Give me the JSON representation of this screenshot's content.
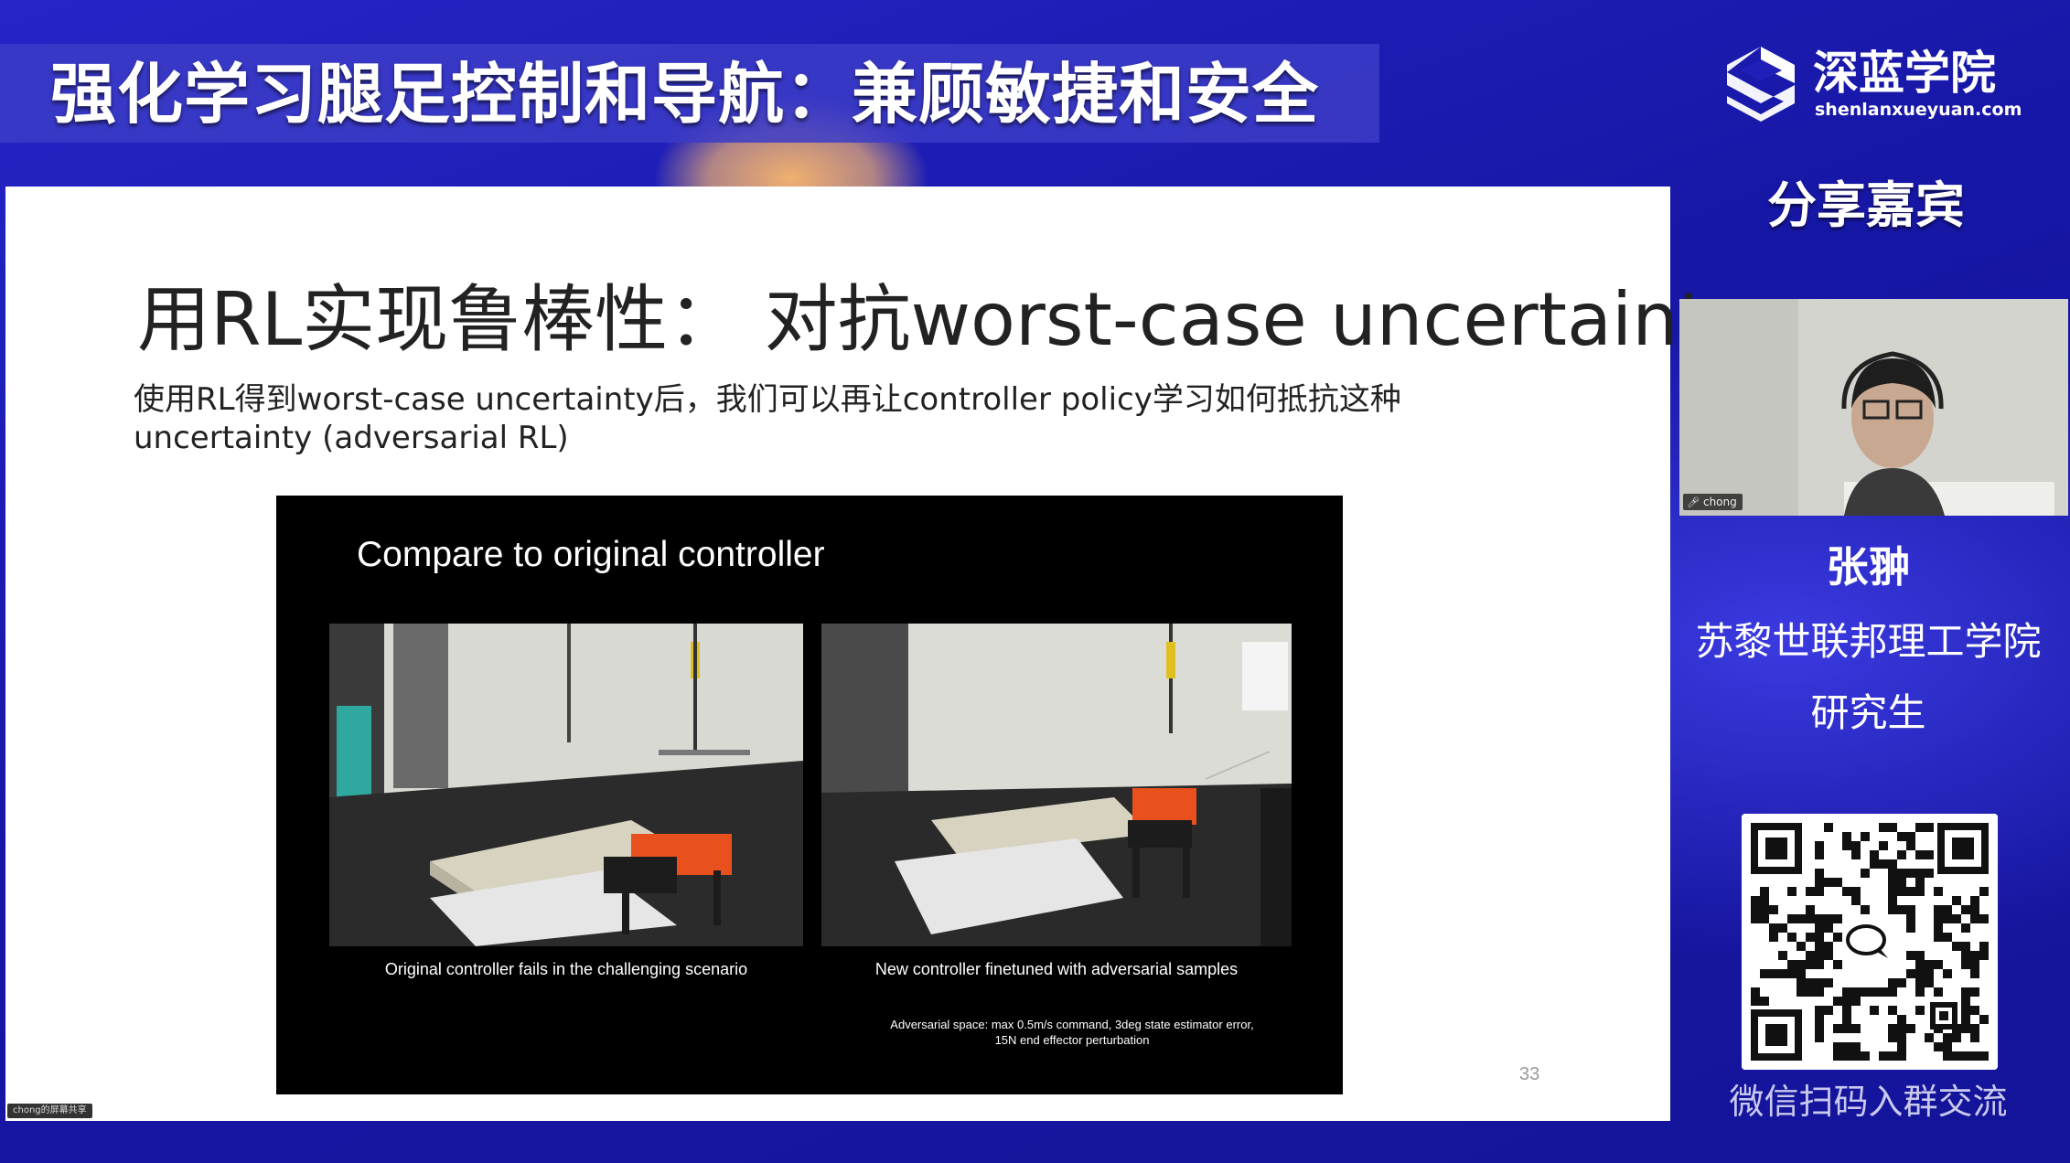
{
  "header": {
    "title": "强化学习腿足控制和导航：兼顾敏捷和安全"
  },
  "brand": {
    "name": "深蓝学院",
    "url": "shenlanxueyuan.com"
  },
  "sidebar": {
    "heading": "分享嘉宾",
    "webcam_label": "chong",
    "speaker_name": "张翀",
    "speaker_affiliation": "苏黎世联邦理工学院",
    "speaker_role": "研究生",
    "qr_caption": "微信扫码入群交流"
  },
  "slide": {
    "title": "用RL实现鲁棒性：  对抗worst-case uncertainty",
    "subtitle": "使用RL得到worst-case uncertainty后，我们可以再让controller policy学习如何抵抗这种uncertainty (adversarial RL)",
    "page_number": "33",
    "video": {
      "title": "Compare to original controller",
      "caption_left": "Original controller fails in the challenging scenario",
      "caption_right": "New controller finetuned with adversarial samples",
      "note_line1": "Adversarial space: max 0.5m/s command, 3deg state estimator error,",
      "note_line2": "15N end effector perturbation"
    }
  },
  "share_badge": "chong的屏幕共享",
  "icons": {
    "brand_logo": "deep-blue-logo-icon",
    "mic": "microphone-icon",
    "qr": "wechat-qr-code"
  },
  "colors": {
    "background": "#1a1aa8",
    "robot": "#e8501e",
    "title_band": "#3c3cc8"
  }
}
